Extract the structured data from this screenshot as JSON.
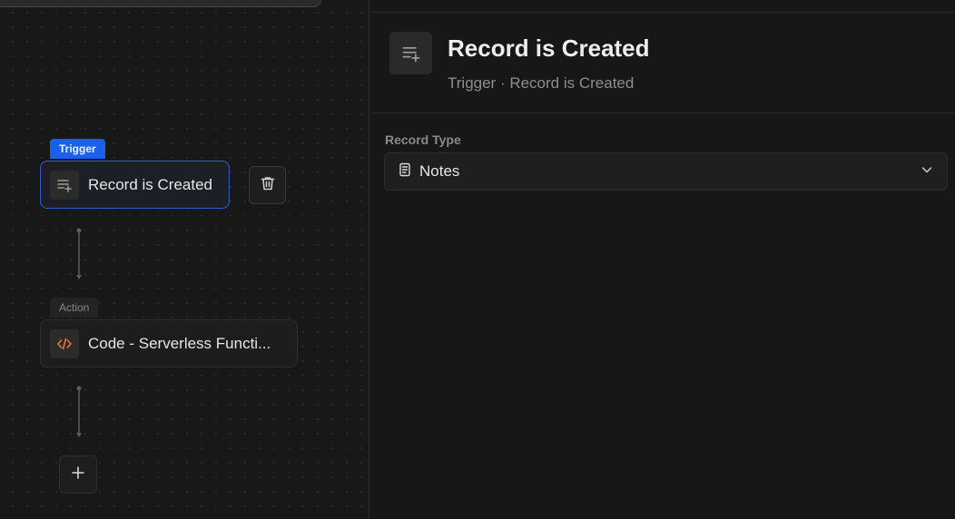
{
  "canvas": {
    "trigger_node": {
      "tag": "Trigger",
      "label": "Record is Created",
      "icon": "record-created-icon"
    },
    "action_node": {
      "tag": "Action",
      "label": "Code - Serverless Functi...",
      "icon": "code-icon"
    },
    "delete_icon": "trash-icon",
    "add_icon": "plus-icon"
  },
  "panel": {
    "header": {
      "title": "Record is Created",
      "subtitle": "Trigger · Record is Created",
      "icon": "record-created-icon"
    },
    "record_type": {
      "label": "Record Type",
      "value": "Notes",
      "icon": "notes-icon"
    }
  },
  "colors": {
    "accent": "#1961ed",
    "code_icon": "#e8743b"
  }
}
